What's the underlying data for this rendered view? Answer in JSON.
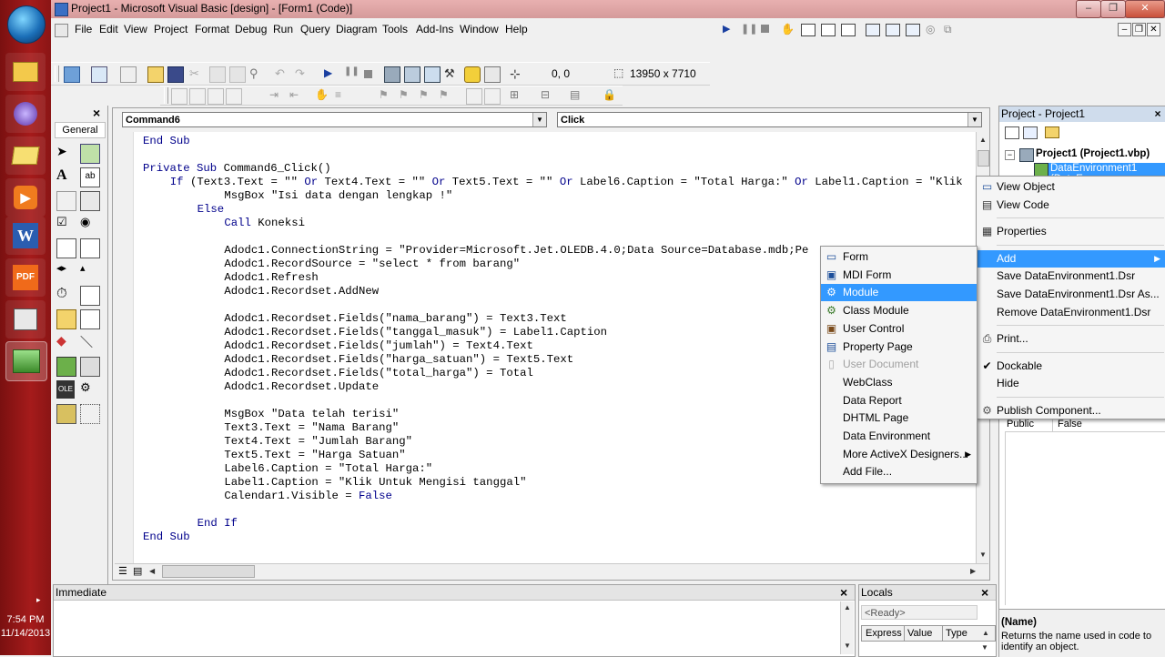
{
  "window": {
    "title": "Project1 - Microsoft Visual Basic [design] - [Form1 (Code)]",
    "min": "‒",
    "restore": "❐",
    "close": "✕"
  },
  "menu": [
    "File",
    "Edit",
    "View",
    "Project",
    "Format",
    "Debug",
    "Run",
    "Query",
    "Diagram",
    "Tools",
    "Add-Ins",
    "Window",
    "Help"
  ],
  "toolbar": {
    "position": "0, 0",
    "size": "13950 x 7710"
  },
  "toolbox": {
    "title": "General",
    "close": "×"
  },
  "code_window": {
    "object_combo": "Command6",
    "procedure_combo": "Click"
  },
  "code_lines": [
    {
      "indent": 0,
      "parts": [
        {
          "k": true,
          "t": "End Sub"
        }
      ]
    },
    {
      "indent": 0,
      "parts": []
    },
    {
      "indent": 0,
      "parts": [
        {
          "k": true,
          "t": "Private Sub "
        },
        {
          "k": false,
          "t": "Command6_Click()"
        }
      ]
    },
    {
      "indent": 4,
      "parts": [
        {
          "k": true,
          "t": "If "
        },
        {
          "k": false,
          "t": "(Text3.Text = \"\" "
        },
        {
          "k": true,
          "t": "Or "
        },
        {
          "k": false,
          "t": "Text4.Text = \"\" "
        },
        {
          "k": true,
          "t": "Or "
        },
        {
          "k": false,
          "t": "Text5.Text = \"\" "
        },
        {
          "k": true,
          "t": "Or "
        },
        {
          "k": false,
          "t": "Label6.Caption = \"Total Harga:\" "
        },
        {
          "k": true,
          "t": "Or "
        },
        {
          "k": false,
          "t": "Label1.Caption = \"Klik"
        }
      ]
    },
    {
      "indent": 12,
      "parts": [
        {
          "k": false,
          "t": "MsgBox \"Isi data dengan lengkap !\""
        }
      ]
    },
    {
      "indent": 8,
      "parts": [
        {
          "k": true,
          "t": "Else"
        }
      ]
    },
    {
      "indent": 12,
      "parts": [
        {
          "k": true,
          "t": "Call "
        },
        {
          "k": false,
          "t": "Koneksi"
        }
      ]
    },
    {
      "indent": 0,
      "parts": []
    },
    {
      "indent": 12,
      "parts": [
        {
          "k": false,
          "t": "Adodc1.ConnectionString = \"Provider=Microsoft.Jet.OLEDB.4.0;Data Source=Database.mdb;Pe"
        }
      ]
    },
    {
      "indent": 12,
      "parts": [
        {
          "k": false,
          "t": "Adodc1.RecordSource = \"select * from barang\""
        }
      ]
    },
    {
      "indent": 12,
      "parts": [
        {
          "k": false,
          "t": "Adodc1.Refresh"
        }
      ]
    },
    {
      "indent": 12,
      "parts": [
        {
          "k": false,
          "t": "Adodc1.Recordset.AddNew"
        }
      ]
    },
    {
      "indent": 0,
      "parts": []
    },
    {
      "indent": 12,
      "parts": [
        {
          "k": false,
          "t": "Adodc1.Recordset.Fields(\"nama_barang\") = Text3.Text"
        }
      ]
    },
    {
      "indent": 12,
      "parts": [
        {
          "k": false,
          "t": "Adodc1.Recordset.Fields(\"tanggal_masuk\") = Label1.Caption"
        }
      ]
    },
    {
      "indent": 12,
      "parts": [
        {
          "k": false,
          "t": "Adodc1.Recordset.Fields(\"jumlah\") = Text4.Text"
        }
      ]
    },
    {
      "indent": 12,
      "parts": [
        {
          "k": false,
          "t": "Adodc1.Recordset.Fields(\"harga_satuan\") = Text5.Text"
        }
      ]
    },
    {
      "indent": 12,
      "parts": [
        {
          "k": false,
          "t": "Adodc1.Recordset.Fields(\"total_harga\") = Total"
        }
      ]
    },
    {
      "indent": 12,
      "parts": [
        {
          "k": false,
          "t": "Adodc1.Recordset.Update"
        }
      ]
    },
    {
      "indent": 0,
      "parts": []
    },
    {
      "indent": 12,
      "parts": [
        {
          "k": false,
          "t": "MsgBox \"Data telah terisi\""
        }
      ]
    },
    {
      "indent": 12,
      "parts": [
        {
          "k": false,
          "t": "Text3.Text = \"Nama Barang\""
        }
      ]
    },
    {
      "indent": 12,
      "parts": [
        {
          "k": false,
          "t": "Text4.Text = \"Jumlah Barang\""
        }
      ]
    },
    {
      "indent": 12,
      "parts": [
        {
          "k": false,
          "t": "Text5.Text = \"Harga Satuan\""
        }
      ]
    },
    {
      "indent": 12,
      "parts": [
        {
          "k": false,
          "t": "Label6.Caption = \"Total Harga:\""
        }
      ]
    },
    {
      "indent": 12,
      "parts": [
        {
          "k": false,
          "t": "Label1.Caption = \"Klik Untuk Mengisi tanggal\""
        }
      ]
    },
    {
      "indent": 12,
      "parts": [
        {
          "k": false,
          "t": "Calendar1.Visible = "
        },
        {
          "k": true,
          "t": "False"
        }
      ]
    },
    {
      "indent": 0,
      "parts": []
    },
    {
      "indent": 8,
      "parts": [
        {
          "k": true,
          "t": "End If"
        }
      ]
    },
    {
      "indent": 0,
      "parts": [
        {
          "k": true,
          "t": "End Sub"
        }
      ]
    }
  ],
  "project_panel": {
    "title": "Project - Project1",
    "close": "×",
    "root": "Project1 (Project1.vbp)",
    "child": "DataEnvironment1 (DataEn"
  },
  "context_menu": {
    "items": [
      {
        "label": "View Object",
        "icon": "view-object-icon"
      },
      {
        "label": "View Code",
        "icon": "view-code-icon"
      },
      {
        "label": "Properties",
        "icon": "properties-icon"
      },
      {
        "label": "Add",
        "icon": "",
        "submenu": true,
        "highlight": true
      },
      {
        "label": "Save DataEnvironment1.Dsr",
        "icon": ""
      },
      {
        "label": "Save DataEnvironment1.Dsr As...",
        "icon": ""
      },
      {
        "label": "Remove DataEnvironment1.Dsr",
        "icon": ""
      },
      {
        "label": "Print...",
        "icon": "print-icon"
      },
      {
        "label": "Dockable",
        "icon": "check-icon",
        "checked": true
      },
      {
        "label": "Hide",
        "icon": ""
      },
      {
        "label": "Publish Component...",
        "icon": "publish-icon"
      }
    ]
  },
  "add_submenu": {
    "items": [
      {
        "label": "Form",
        "icon": "form-icon"
      },
      {
        "label": "MDI Form",
        "icon": "mdi-form-icon"
      },
      {
        "label": "Module",
        "icon": "module-icon",
        "highlight": true
      },
      {
        "label": "Class Module",
        "icon": "class-module-icon"
      },
      {
        "label": "User Control",
        "icon": "user-control-icon"
      },
      {
        "label": "Property Page",
        "icon": "property-page-icon"
      },
      {
        "label": "User Document",
        "icon": "user-document-icon",
        "disabled": true
      },
      {
        "label": "WebClass",
        "icon": ""
      },
      {
        "label": "Data Report",
        "icon": ""
      },
      {
        "label": "DHTML Page",
        "icon": ""
      },
      {
        "label": "Data Environment",
        "icon": ""
      },
      {
        "label": "More ActiveX Designers...",
        "icon": "",
        "submenu": true
      },
      {
        "label": "Add File...",
        "icon": ""
      }
    ]
  },
  "properties_panel": {
    "row_name": "Public",
    "row_value": "False",
    "desc_title": "(Name)",
    "desc_text": "Returns the name used in code to identify an object."
  },
  "immediate": {
    "title": "Immediate",
    "close": "×"
  },
  "locals": {
    "title": "Locals",
    "close": "×",
    "status": "<Ready>",
    "columns": [
      "Express",
      "Value",
      "Type"
    ]
  },
  "clock": {
    "time": "7:54 PM",
    "date": "11/14/2013"
  },
  "taskbar_arrow": "▸"
}
